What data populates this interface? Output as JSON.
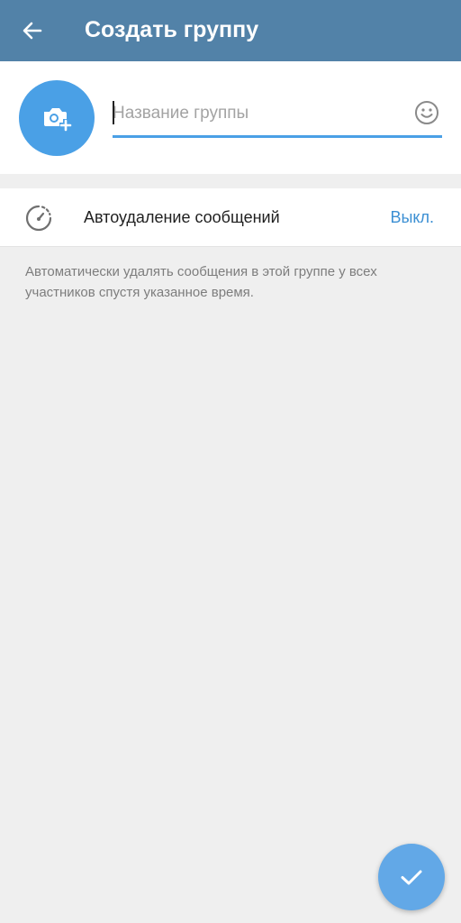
{
  "app_bar": {
    "title": "Создать группу",
    "back_icon": "arrow-left-icon",
    "background_color": "#5282a8"
  },
  "group_header": {
    "avatar_icon": "camera-add-icon",
    "avatar_color": "#4aa0e6",
    "name_input": {
      "value": "",
      "placeholder": "Название группы"
    },
    "emoji_icon": "smiley-icon"
  },
  "auto_delete": {
    "icon": "timer-icon",
    "label": "Автоудаление сообщений",
    "value": "Выкл."
  },
  "hint": "Автоматически удалять сообщения в этой группе у всех участников спустя указанное время.",
  "fab": {
    "icon": "check-icon",
    "color": "#62a8e7"
  }
}
